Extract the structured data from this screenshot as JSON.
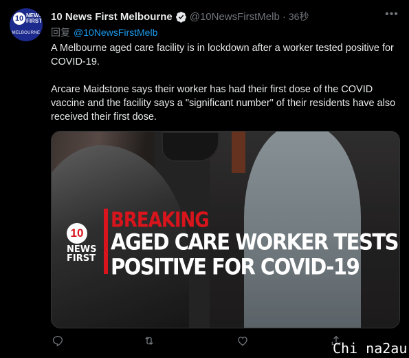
{
  "author": {
    "name": "10 News First Melbourne",
    "handle": "@10NewsFirstMelb",
    "time": "36秒"
  },
  "avatar": {
    "ten": "10",
    "news": "NEWS\nFIRST",
    "city": "MELBOURNE"
  },
  "reply": {
    "label": "回复",
    "mention": "@10NewsFirstMelb"
  },
  "tweet": {
    "paragraph1": "A Melbourne aged care facility is in lockdown after a worker tested positive for COVID-19.",
    "paragraph2": "Arcare Maidstone says their worker has had their first dose of the COVID vaccine and the facility says a \"significant number\" of their residents have also received their first dose."
  },
  "media": {
    "logo_number": "10",
    "logo_text": "NEWS\nFIRST",
    "breaking": "BREAKING",
    "headline_line1": "AGED CARE WORKER TESTS",
    "headline_line2": "POSITIVE FOR COVID-19"
  },
  "actions": [
    "reply-icon",
    "retweet-icon",
    "like-icon",
    "share-icon"
  ],
  "watermark": "Chi na2au",
  "colors": {
    "background": "#000000",
    "link": "#1d9bf0",
    "muted": "#71767b",
    "breaking_red": "#d8141c",
    "verified": "#e7e9ea"
  }
}
